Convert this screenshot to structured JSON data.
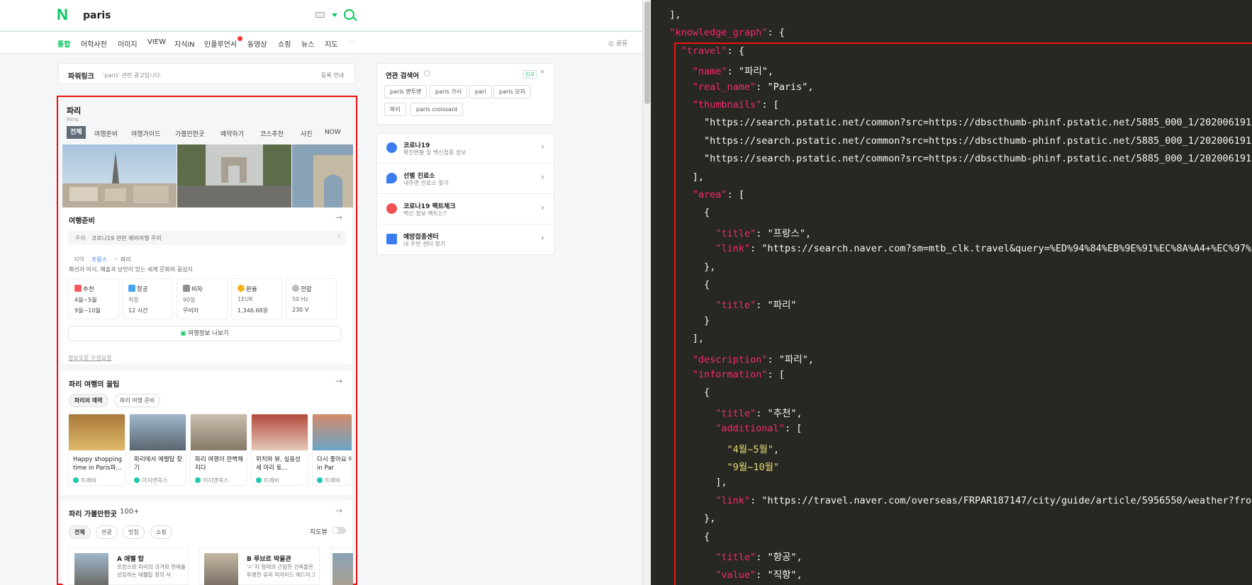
{
  "search": {
    "query": "paris",
    "logo": "N"
  },
  "tabs": [
    {
      "label": "통합"
    },
    {
      "label": "어학사전"
    },
    {
      "label": "이미지"
    },
    {
      "label": "VIEW"
    },
    {
      "label": "지식iN"
    },
    {
      "label": "인플루언서"
    },
    {
      "label": "동영상"
    },
    {
      "label": "쇼핑"
    },
    {
      "label": "뉴스"
    },
    {
      "label": "지도"
    },
    {
      "label": "···"
    }
  ],
  "share_label": "공유",
  "powerlink": {
    "title": "파워링크",
    "desc": "'paris' 관련 광고입니다.",
    "register": "등록 안내"
  },
  "travel": {
    "name": "파리",
    "real_name": "Paris",
    "subtabs": [
      "전체",
      "여행준비",
      "여행가이드",
      "가볼만한곳",
      "예약하기",
      "코스추천",
      "사진",
      "NOW"
    ],
    "prep_title": "여행준비",
    "notice_label": "주의",
    "notice_text": "코로나19 관련 해외여행 주의",
    "region_label": "지역",
    "region_country": "프랑스",
    "region_city": "파리",
    "description": "패션과 미식, 예술과 낭만이 있는 세계 문화의 중심지",
    "info": [
      {
        "title": "추천",
        "v1": "4월~5월",
        "v2": "9월~10월",
        "color": "#f0595e"
      },
      {
        "title": "항공",
        "v1": "직항",
        "v2": "12 시간",
        "color": "#4aa3f0"
      },
      {
        "title": "비자",
        "v1": "90일",
        "v2": "무비자",
        "color": "#8e8e8e"
      },
      {
        "title": "환율",
        "v1": "1EUR",
        "v2": "1,346.68원",
        "color": "#f5b21b"
      },
      {
        "title": "전압",
        "v1": "50 Hz",
        "v2": "230 V",
        "color": "#bbbbbb"
      }
    ],
    "share_btn": "여행정보 나보기",
    "edit_link": "정보오류 수정요청",
    "tips_title": "파리 여행의 꿀팁",
    "tips_chips": [
      "파리의 매력",
      "파리 여행 준비"
    ],
    "tips": [
      {
        "title": "Happy shopping time in Paris파...",
        "src": "트래비"
      },
      {
        "title": "파리에서 에펠탑 찾기",
        "src": "이지앤북스"
      },
      {
        "title": "파리 여행이 완벽해지다",
        "src": "이지앤북스"
      },
      {
        "title": "위치와 뷰, 실용성 세 마리 토...",
        "src": "트래비"
      },
      {
        "title": "다시 좋아요 에포르 in Par",
        "src": "트래비"
      }
    ],
    "places_title": "파리 가볼만한곳",
    "places_count": "100+",
    "places_chips": [
      "전체",
      "관광",
      "맛집",
      "쇼핑"
    ],
    "mapview": "지도뷰",
    "places": [
      {
        "name": "A 에펠 탑",
        "desc": "프랑스와 파리의 과거와 현재를 상징하는 에펠탑 정의 사"
      },
      {
        "name": "B 루브르 박물관",
        "desc": "'ㄷ'자 형태의 근엄한 건축물은 투명한 유리 피라미드 에드미그"
      }
    ]
  },
  "related": {
    "title": "연관 검색어",
    "chips": [
      "paris 맨투맨",
      "paris 가사",
      "pari",
      "paris 모자",
      "파리",
      "paris croissant"
    ],
    "report": "신고"
  },
  "side_items": [
    {
      "title": "코로나19",
      "sub": "확진현황 및 백신접종 정보",
      "color": "#3b7cf0"
    },
    {
      "title": "선별 진료소",
      "sub": "내주변 진료소 찾기",
      "color": "#3b7cf0"
    },
    {
      "title": "코로나19 팩트체크",
      "sub": "백신 정보 팩트는?",
      "color": "#f05050"
    },
    {
      "title": "예방접종센터",
      "sub": "내 주변 센터 찾기",
      "color": "#3b7cf0"
    }
  ],
  "code": [
    {
      "t": "  ],"
    },
    {
      "t": "  \"knowledge_graph\": {"
    },
    {
      "t": "    \"travel\": {"
    },
    {
      "t": "      \"name\": \"파리\","
    },
    {
      "t": "      \"real_name\": \"Paris\","
    },
    {
      "t": "      \"thumbnails\": ["
    },
    {
      "t": "        \"https://search.pstatic.net/common?src=https://dbscthumb-phinf.pstatic.net/5885_000_1/202006191"
    },
    {
      "t": "        \"https://search.pstatic.net/common?src=https://dbscthumb-phinf.pstatic.net/5885_000_1/202006191"
    },
    {
      "t": "        \"https://search.pstatic.net/common?src=https://dbscthumb-phinf.pstatic.net/5885_000_1/202006191"
    },
    {
      "t": "      ],"
    },
    {
      "t": "      \"area\": ["
    },
    {
      "t": "        {"
    },
    {
      "t": "          \"title\": \"프랑스\","
    },
    {
      "t": "          \"link\": \"https://search.naver.com?sm=mtb_clk.travel&query=%ED%94%84%EB%9E%91%EC%8A%A4+%EC%97%"
    },
    {
      "t": "        },"
    },
    {
      "t": "        {"
    },
    {
      "t": "          \"title\": \"파리\""
    },
    {
      "t": "        }"
    },
    {
      "t": "      ],"
    },
    {
      "t": "      \"description\": \"파리\","
    },
    {
      "t": "      \"information\": ["
    },
    {
      "t": "        {"
    },
    {
      "t": "          \"title\": \"추천\","
    },
    {
      "t": "          \"additional\": ["
    },
    {
      "t": "            \"4월~5월\","
    },
    {
      "t": "            \"9월~10월\""
    },
    {
      "t": "          ],"
    },
    {
      "t": "          \"link\": \"https://travel.naver.com/overseas/FRPAR187147/city/guide/article/5956550/weather?fro"
    },
    {
      "t": "        },"
    },
    {
      "t": "        {"
    },
    {
      "t": "          \"title\": \"항공\","
    },
    {
      "t": "          \"value\": \"직항\","
    }
  ]
}
